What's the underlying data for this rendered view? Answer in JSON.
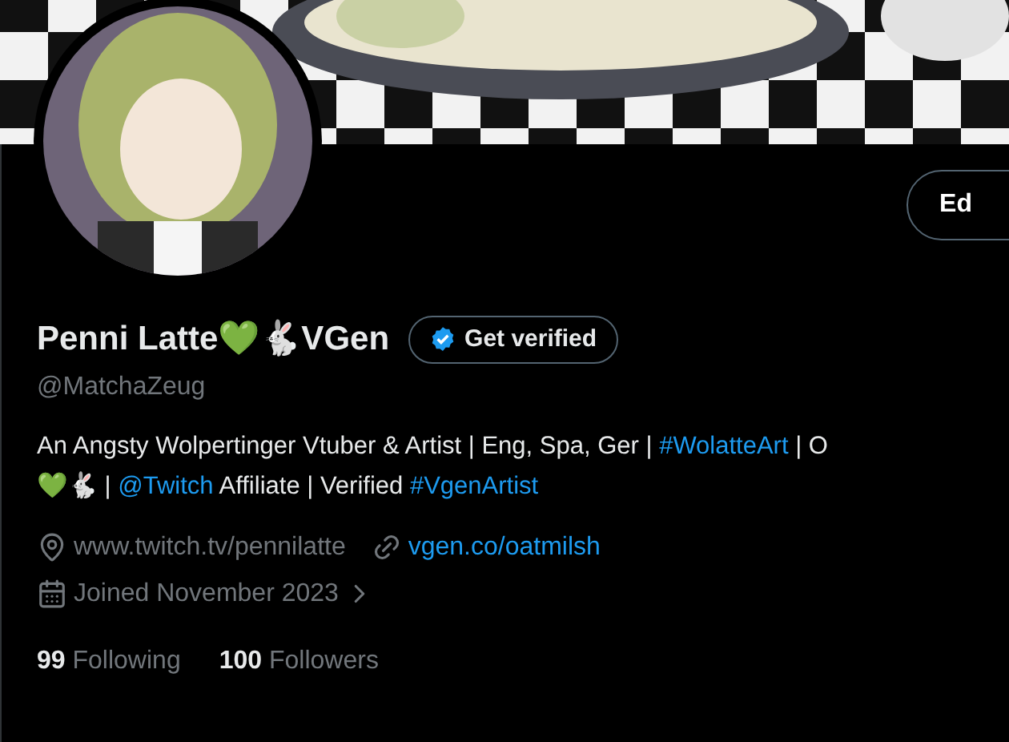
{
  "edit_button": {
    "label": "Ed"
  },
  "profile": {
    "name": "Penni Latte💚🐇VGen",
    "verify_button": "Get verified",
    "handle": "@MatchaZeug"
  },
  "bio": {
    "lines": [
      [
        {
          "kind": "text",
          "text": "An Angsty Wolpertinger Vtuber & Artist | Eng, Spa, Ger | "
        },
        {
          "kind": "hashtag",
          "text": "#WolatteArt"
        },
        {
          "kind": "text",
          "text": " | O"
        }
      ],
      [
        {
          "kind": "text",
          "text": "💚🐇 | "
        },
        {
          "kind": "mention",
          "text": "@Twitch"
        },
        {
          "kind": "text",
          "text": " Affiliate | Verified "
        },
        {
          "kind": "hashtag",
          "text": "#VgenArtist"
        }
      ]
    ]
  },
  "details": [
    [
      {
        "kind": "location",
        "text": "www.twitch.tv/pennilatte"
      },
      {
        "kind": "website",
        "text": "vgen.co/oatmilsh"
      }
    ],
    [
      {
        "kind": "joined",
        "text": "Joined November 2023"
      }
    ]
  ],
  "stats": [
    {
      "count": "99",
      "label": "Following"
    },
    {
      "count": "100",
      "label": "Followers"
    }
  ]
}
